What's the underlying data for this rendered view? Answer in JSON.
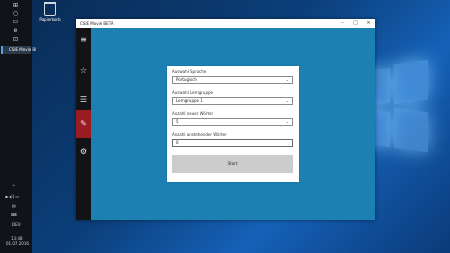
{
  "desktop": {
    "recycle_bin_label": "Papierkorb"
  },
  "taskbar": {
    "app_label": "CSIE Movie Bl",
    "tray_time": "13:48",
    "tray_date": "01.07.2016",
    "tray_lang": "DEU"
  },
  "window": {
    "title": "CSIE Movie BETA",
    "controls": {
      "minimize": "–",
      "maximize": "□",
      "close": "×"
    }
  },
  "rail": {
    "items": [
      {
        "icon": "hamburger-icon"
      },
      {
        "icon": "star-list-icon"
      },
      {
        "icon": "list-icon"
      },
      {
        "icon": "learn-icon"
      },
      {
        "icon": "gear-icon"
      }
    ]
  },
  "form": {
    "language_label": "Auswahl Sprache",
    "language_value": "Portugisch",
    "group_label": "Auswahl Lerngruppe",
    "group_value": "Lerngruppe 1",
    "new_words_label": "Anzahl neuer Wörter",
    "new_words_value": "5",
    "pending_label": "Anzahl anstehender Wörter",
    "pending_value": "0",
    "start_label": "Start"
  },
  "colors": {
    "accent": "#1c80b3",
    "rail": "#111317",
    "active": "#9b1b22"
  }
}
